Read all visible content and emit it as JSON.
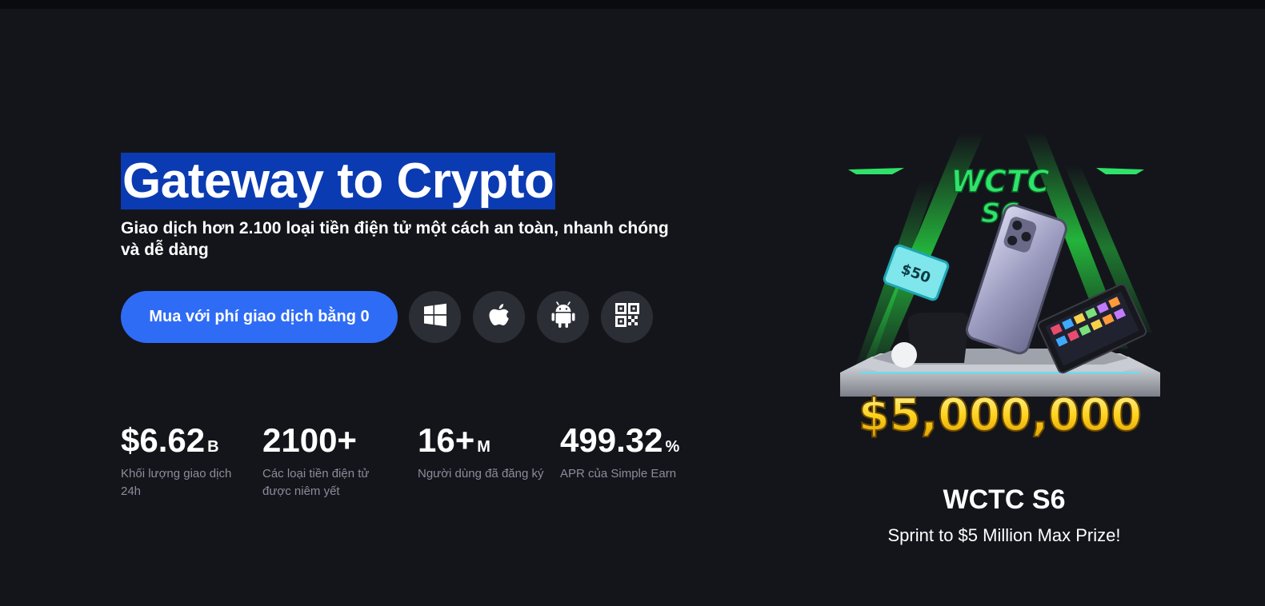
{
  "hero": {
    "headline": "Gateway to Crypto",
    "subtitle": "Giao dịch hơn 2.100 loại tiền điện tử một cách an toàn, nhanh chóng và dễ dàng",
    "cta_label": "Mua với phí giao dịch bằng 0"
  },
  "platforms": [
    {
      "name": "windows",
      "icon": "windows-icon"
    },
    {
      "name": "apple",
      "icon": "apple-icon"
    },
    {
      "name": "android",
      "icon": "android-icon"
    },
    {
      "name": "qr",
      "icon": "qr-code-icon"
    }
  ],
  "stats": [
    {
      "value": "$6.62",
      "unit": "B",
      "label": "Khối lượng giao dịch 24h"
    },
    {
      "value": "2100+",
      "unit": "",
      "label": "Các loại tiền điện tử được niêm yết"
    },
    {
      "value": "16+",
      "unit": "M",
      "label": "Người dùng đã đăng ký"
    },
    {
      "value": "499.32",
      "unit": "%",
      "label": "APR của Simple Earn"
    }
  ],
  "promo": {
    "banner_logo_text": "WCTC S6",
    "voucher_text": "$50",
    "prize_text": "$5,000,000",
    "title": "WCTC S6",
    "subtitle": "Sprint to $5 Million Max Prize!"
  },
  "colors": {
    "background": "#14151b",
    "accent": "#2f6cf6",
    "headline_highlight": "#0b3bb2",
    "icon_button": "#2c2e36",
    "muted_text": "#8a8d99"
  }
}
